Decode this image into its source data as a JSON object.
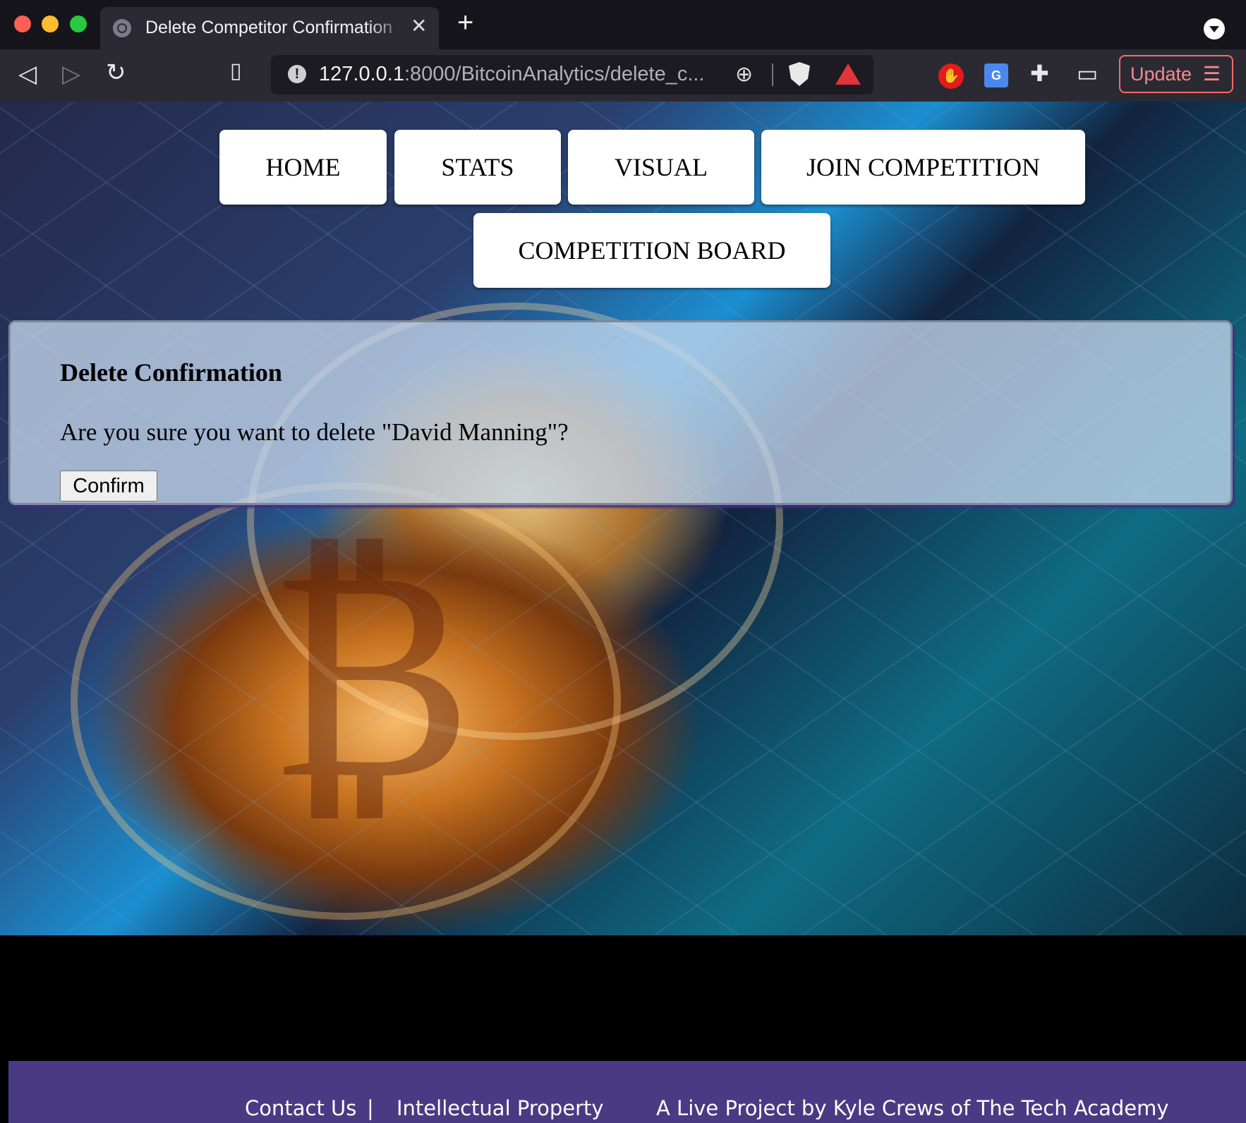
{
  "browser": {
    "tab_title": "Delete Competitor Confirmation",
    "tab_close": "✕",
    "new_tab": "+",
    "url_host": "127.0.0.1",
    "url_rest": ":8000/BitcoinAnalytics/delete_c...",
    "update_label": "Update",
    "update_menu": "☰"
  },
  "nav": {
    "home": "HOME",
    "stats": "STATS",
    "visual": "VISUAL",
    "join": "JOIN COMPETITION",
    "board": "COMPETITION BOARD"
  },
  "confirm": {
    "title": "Delete Confirmation",
    "message": "Are you sure you want to delete \"David Manning\"?",
    "button": "Confirm"
  },
  "footer": {
    "contact": "Contact Us",
    "separator": "|",
    "ip": "Intellectual Property",
    "credit": "A Live Project by Kyle Crews of The Tech Academy"
  },
  "colors": {
    "footer_bg": "#4a3a84",
    "update_accent": "#f26c6c"
  },
  "icons": [
    "back-icon",
    "forward-icon",
    "reload-icon",
    "bookmark-icon",
    "site-info-icon",
    "zoom-icon",
    "brave-shield-icon",
    "brave-rewards-icon",
    "adblock-stop-icon",
    "translate-icon",
    "extensions-icon",
    "wallet-icon"
  ]
}
